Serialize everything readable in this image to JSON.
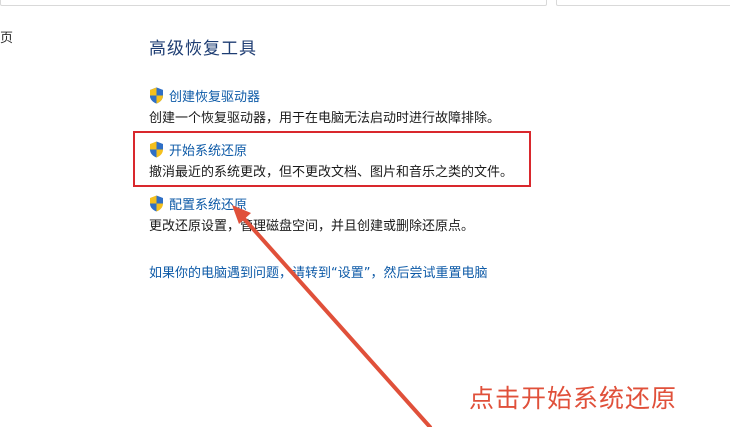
{
  "side_text": "页",
  "heading": "高级恢复工具",
  "tools": [
    {
      "title": "创建恢复驱动器",
      "description": "创建一个恢复驱动器，用于在电脑无法启动时进行故障排除。"
    },
    {
      "title": "开始系统还原",
      "description": "撤消最近的系统更改，但不更改文档、图片和音乐之类的文件。"
    },
    {
      "title": "配置系统还原",
      "description": "更改还原设置，管理磁盘空间，并且创建或删除还原点。"
    }
  ],
  "footer_link": "如果你的电脑遇到问题，请转到“设置”，然后尝试重置电脑",
  "annotation": {
    "label": "点击开始系统还原",
    "color": "#e0503a"
  },
  "colors": {
    "link": "#0d5aa7",
    "heading": "#1e3d73",
    "highlight": "#d9282d"
  },
  "icons": {
    "tool": "uac-shield-icon"
  }
}
